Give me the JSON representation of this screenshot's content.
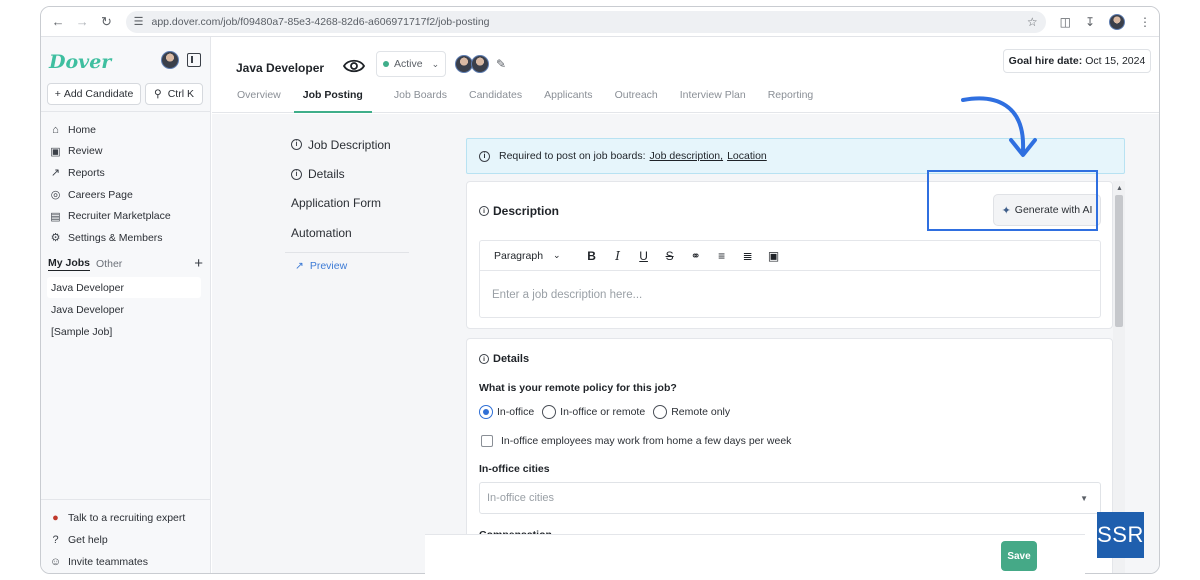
{
  "browser": {
    "url": "app.dover.com/job/f09480a7-85e3-4268-82d6-a606971717f2/job-posting"
  },
  "sidebar": {
    "logo": "Dover",
    "add_candidate": "Add Candidate",
    "search_shortcut": "Ctrl K",
    "nav": [
      {
        "label": "Home",
        "icon": "home-icon"
      },
      {
        "label": "Review",
        "icon": "review-icon"
      },
      {
        "label": "Reports",
        "icon": "trend-icon"
      },
      {
        "label": "Careers Page",
        "icon": "globe-icon"
      },
      {
        "label": "Recruiter Marketplace",
        "icon": "store-icon"
      },
      {
        "label": "Settings & Members",
        "icon": "gear-icon"
      }
    ],
    "my_jobs_tab": "My Jobs",
    "other_tab": "Other",
    "jobs": [
      "Java Developer",
      "Java Developer",
      "[Sample Job]"
    ],
    "bottom": [
      {
        "label": "Talk to a recruiting expert",
        "icon": "expert-avatar-icon"
      },
      {
        "label": "Get help",
        "icon": "help-icon"
      },
      {
        "label": "Invite teammates",
        "icon": "invite-icon"
      }
    ]
  },
  "header": {
    "job_title": "Java Developer",
    "status": "Active",
    "goal_label": "Goal hire date:",
    "goal_date": "Oct 15, 2024",
    "tabs": [
      "Overview",
      "Job Posting",
      "Job Boards",
      "Candidates",
      "Applicants",
      "Outreach",
      "Interview Plan",
      "Reporting"
    ],
    "active_tab": "Job Posting"
  },
  "section_nav": {
    "items": [
      "Job Description",
      "Details",
      "Application Form",
      "Automation"
    ],
    "preview": "Preview"
  },
  "banner": {
    "text": "Required to post on job boards:",
    "link1": "Job description,",
    "link2": "Location"
  },
  "description": {
    "title": "Description",
    "generate_button": "Generate with AI",
    "format_dropdown": "Paragraph",
    "placeholder": "Enter a job description here..."
  },
  "details": {
    "title": "Details",
    "remote_question": "What is your remote policy for this job?",
    "options": [
      "In-office",
      "In-office or remote",
      "Remote only"
    ],
    "selected_option": "In-office",
    "checkbox_label": "In-office employees may work from home a few days per week",
    "cities_label": "In-office cities",
    "cities_placeholder": "In-office cities",
    "compensation_label": "Compensation"
  },
  "save_button": "Save",
  "watermark": "SSR",
  "colors": {
    "brand": "#3fbfa0",
    "accent_green": "#45a987",
    "highlight_blue": "#2f6fe0",
    "banner_bg": "#e6f5fb"
  }
}
